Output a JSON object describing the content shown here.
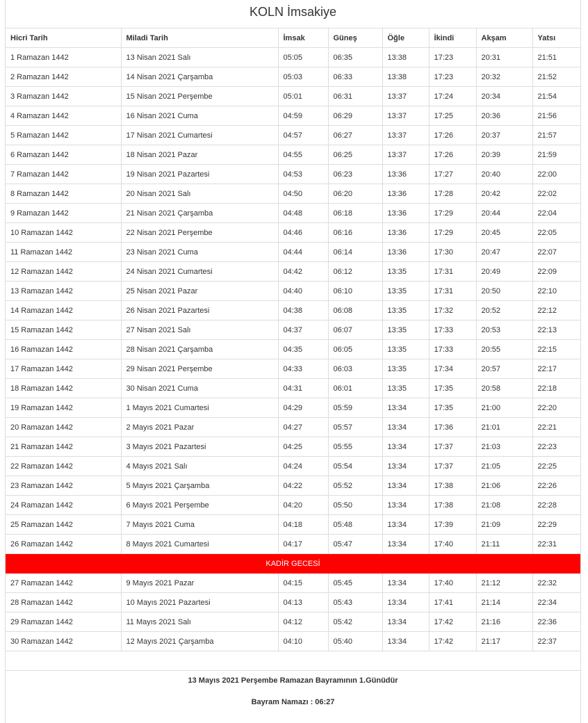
{
  "title": "KOLN İmsakiye",
  "columns": [
    "Hicri Tarih",
    "Miladi Tarih",
    "İmsak",
    "Güneş",
    "Öğle",
    "İkindi",
    "Akşam",
    "Yatsı"
  ],
  "rows": [
    [
      "1 Ramazan 1442",
      "13 Nisan 2021 Salı",
      "05:05",
      "06:35",
      "13:38",
      "17:23",
      "20:31",
      "21:51"
    ],
    [
      "2 Ramazan 1442",
      "14 Nisan 2021 Çarşamba",
      "05:03",
      "06:33",
      "13:38",
      "17:23",
      "20:32",
      "21:52"
    ],
    [
      "3 Ramazan 1442",
      "15 Nisan 2021 Perşembe",
      "05:01",
      "06:31",
      "13:37",
      "17:24",
      "20:34",
      "21:54"
    ],
    [
      "4 Ramazan 1442",
      "16 Nisan 2021 Cuma",
      "04:59",
      "06:29",
      "13:37",
      "17:25",
      "20:36",
      "21:56"
    ],
    [
      "5 Ramazan 1442",
      "17 Nisan 2021 Cumartesi",
      "04:57",
      "06:27",
      "13:37",
      "17:26",
      "20:37",
      "21:57"
    ],
    [
      "6 Ramazan 1442",
      "18 Nisan 2021 Pazar",
      "04:55",
      "06:25",
      "13:37",
      "17:26",
      "20:39",
      "21:59"
    ],
    [
      "7 Ramazan 1442",
      "19 Nisan 2021 Pazartesi",
      "04:53",
      "06:23",
      "13:36",
      "17:27",
      "20:40",
      "22:00"
    ],
    [
      "8 Ramazan 1442",
      "20 Nisan 2021 Salı",
      "04:50",
      "06:20",
      "13:36",
      "17:28",
      "20:42",
      "22:02"
    ],
    [
      "9 Ramazan 1442",
      "21 Nisan 2021 Çarşamba",
      "04:48",
      "06:18",
      "13:36",
      "17:29",
      "20:44",
      "22:04"
    ],
    [
      "10 Ramazan 1442",
      "22 Nisan 2021 Perşembe",
      "04:46",
      "06:16",
      "13:36",
      "17:29",
      "20:45",
      "22:05"
    ],
    [
      "11 Ramazan 1442",
      "23 Nisan 2021 Cuma",
      "04:44",
      "06:14",
      "13:36",
      "17:30",
      "20:47",
      "22:07"
    ],
    [
      "12 Ramazan 1442",
      "24 Nisan 2021 Cumartesi",
      "04:42",
      "06:12",
      "13:35",
      "17:31",
      "20:49",
      "22:09"
    ],
    [
      "13 Ramazan 1442",
      "25 Nisan 2021 Pazar",
      "04:40",
      "06:10",
      "13:35",
      "17:31",
      "20:50",
      "22:10"
    ],
    [
      "14 Ramazan 1442",
      "26 Nisan 2021 Pazartesi",
      "04:38",
      "06:08",
      "13:35",
      "17:32",
      "20:52",
      "22:12"
    ],
    [
      "15 Ramazan 1442",
      "27 Nisan 2021 Salı",
      "04:37",
      "06:07",
      "13:35",
      "17:33",
      "20:53",
      "22:13"
    ],
    [
      "16 Ramazan 1442",
      "28 Nisan 2021 Çarşamba",
      "04:35",
      "06:05",
      "13:35",
      "17:33",
      "20:55",
      "22:15"
    ],
    [
      "17 Ramazan 1442",
      "29 Nisan 2021 Perşembe",
      "04:33",
      "06:03",
      "13:35",
      "17:34",
      "20:57",
      "22:17"
    ],
    [
      "18 Ramazan 1442",
      "30 Nisan 2021 Cuma",
      "04:31",
      "06:01",
      "13:35",
      "17:35",
      "20:58",
      "22:18"
    ],
    [
      "19 Ramazan 1442",
      "1 Mayıs 2021 Cumartesi",
      "04:29",
      "05:59",
      "13:34",
      "17:35",
      "21:00",
      "22:20"
    ],
    [
      "20 Ramazan 1442",
      "2 Mayıs 2021 Pazar",
      "04:27",
      "05:57",
      "13:34",
      "17:36",
      "21:01",
      "22:21"
    ],
    [
      "21 Ramazan 1442",
      "3 Mayıs 2021 Pazartesi",
      "04:25",
      "05:55",
      "13:34",
      "17:37",
      "21:03",
      "22:23"
    ],
    [
      "22 Ramazan 1442",
      "4 Mayıs 2021 Salı",
      "04:24",
      "05:54",
      "13:34",
      "17:37",
      "21:05",
      "22:25"
    ],
    [
      "23 Ramazan 1442",
      "5 Mayıs 2021 Çarşamba",
      "04:22",
      "05:52",
      "13:34",
      "17:38",
      "21:06",
      "22:26"
    ],
    [
      "24 Ramazan 1442",
      "6 Mayıs 2021 Perşembe",
      "04:20",
      "05:50",
      "13:34",
      "17:38",
      "21:08",
      "22:28"
    ],
    [
      "25 Ramazan 1442",
      "7 Mayıs 2021 Cuma",
      "04:18",
      "05:48",
      "13:34",
      "17:39",
      "21:09",
      "22:29"
    ],
    [
      "26 Ramazan 1442",
      "8 Mayıs 2021 Cumartesi",
      "04:17",
      "05:47",
      "13:34",
      "17:40",
      "21:11",
      "22:31"
    ]
  ],
  "special_row": {
    "label": "KADİR GECESİ",
    "color": "#ff0000"
  },
  "rows_after": [
    [
      "27 Ramazan 1442",
      "9 Mayıs 2021 Pazar",
      "04:15",
      "05:45",
      "13:34",
      "17:40",
      "21:12",
      "22:32"
    ],
    [
      "28 Ramazan 1442",
      "10 Mayıs 2021 Pazartesi",
      "04:13",
      "05:43",
      "13:34",
      "17:41",
      "21:14",
      "22:34"
    ],
    [
      "29 Ramazan 1442",
      "11 Mayıs 2021 Salı",
      "04:12",
      "05:42",
      "13:34",
      "17:42",
      "21:16",
      "22:36"
    ],
    [
      "30 Ramazan 1442",
      "12 Mayıs 2021 Çarşamba",
      "04:10",
      "05:40",
      "13:34",
      "17:42",
      "21:17",
      "22:37"
    ]
  ],
  "footer": {
    "bayram_note": "13 Mayıs 2021 Perşembe Ramazan Bayramının 1.Günüdür",
    "bayram_namazi": "Bayram Namazı : 06:27"
  }
}
